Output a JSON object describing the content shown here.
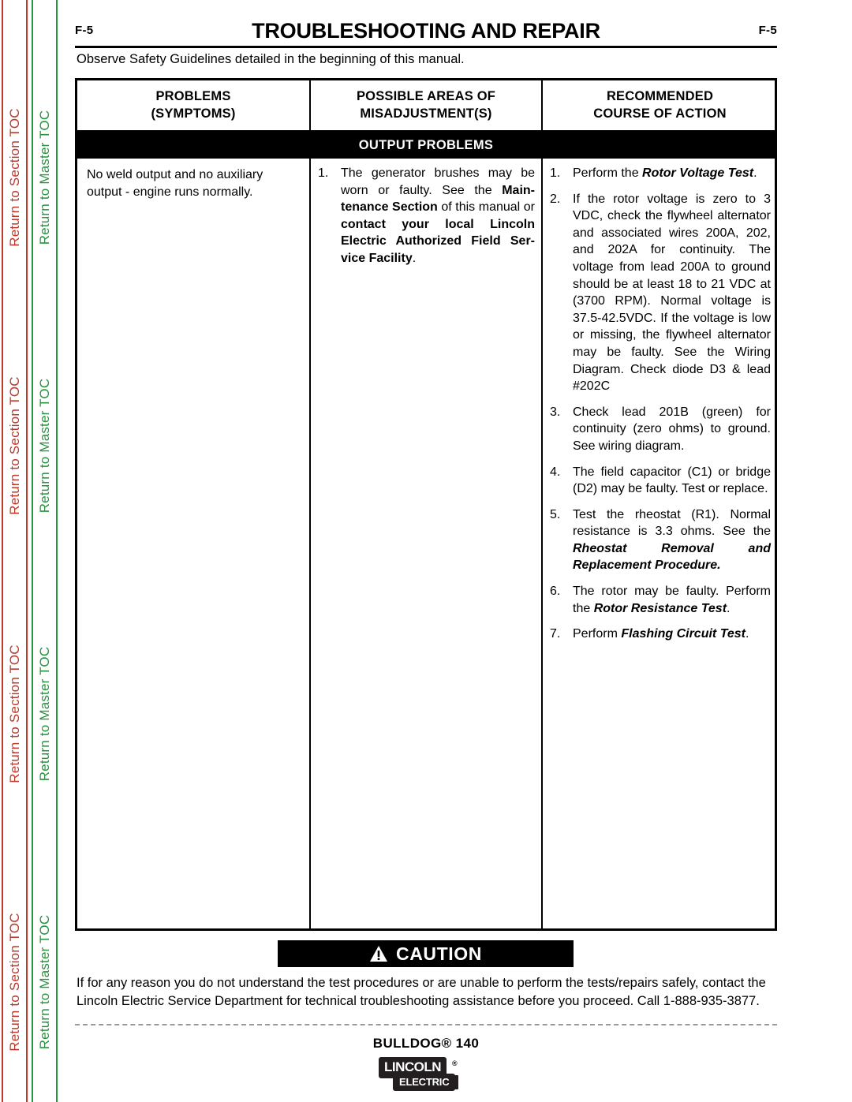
{
  "sidebar": {
    "section_toc_label": "Return to Section TOC",
    "master_toc_label": "Return to Master TOC",
    "section_toc_color": "#c0392b",
    "master_toc_color": "#27943f"
  },
  "header": {
    "folio_left": "F-5",
    "folio_right": "F-5",
    "title": "TROUBLESHOOTING AND REPAIR",
    "intro": "Observe Safety Guidelines detailed in the beginning of this manual."
  },
  "table": {
    "columns": [
      {
        "line1": "PROBLEMS",
        "line2": "(SYMPTOMS)"
      },
      {
        "line1": "POSSIBLE AREAS OF",
        "line2": "MISADJUSTMENT(S)"
      },
      {
        "line1": "RECOMMENDED",
        "line2": "COURSE OF ACTION"
      }
    ],
    "section_bar": "OUTPUT PROBLEMS",
    "symptom": "No weld output and no auxiliary output - engine runs normally.",
    "possible_areas": [
      {
        "num": "1.",
        "parts": [
          {
            "text": "The generator brushes may be worn or faulty.  See the ",
            "style": "normal"
          },
          {
            "text": "Main",
            "style": "bold"
          },
          {
            "text": "-",
            "style": "bold"
          },
          {
            "text": "tenance Section",
            "style": "bold"
          },
          {
            "text": " of this manual or ",
            "style": "normal"
          },
          {
            "text": "contact your local Lincoln Electric Authorized Field Ser",
            "style": "bold"
          },
          {
            "text": "-",
            "style": "bold"
          },
          {
            "text": "vice Facility",
            "style": "bold"
          },
          {
            "text": ".",
            "style": "normal"
          }
        ]
      }
    ],
    "course_of_action": [
      {
        "num": "1.",
        "parts": [
          {
            "text": "Perform the ",
            "style": "normal"
          },
          {
            "text": "Rotor Voltage Test",
            "style": "bolditalic"
          },
          {
            "text": ".",
            "style": "normal"
          }
        ]
      },
      {
        "num": "2.",
        "parts": [
          {
            "text": "If the rotor voltage is zero to 3 VDC, check the flywheel alternator and associated wires 200A, 202, and 202A for continuity.  The voltage from lead 200A to ground should be at least 18 to 21 VDC at (3700 RPM).  Normal voltage is 37.5-42.5VDC.  If the voltage is low or missing, the flywheel alternator may be faulty.  See the Wiring Diagram.  Check diode D3 & lead #202C",
            "style": "normal"
          }
        ]
      },
      {
        "num": "3.",
        "parts": [
          {
            "text": "Check lead 201B (green) for continuity (zero ohms) to ground.  See wiring diagram.",
            "style": "normal"
          }
        ]
      },
      {
        "num": "4.",
        "parts": [
          {
            "text": "The field capacitor (C1) or bridge (D2) may be faulty. Test or replace.",
            "style": "normal"
          }
        ]
      },
      {
        "num": "5.",
        "parts": [
          {
            "text": "Test the rheostat (R1).  Normal resistance is 3.3 ohms.  See the ",
            "style": "normal"
          },
          {
            "text": "Rheostat Removal and Replacement Procedure.",
            "style": "bolditalic"
          }
        ]
      },
      {
        "num": "6.",
        "parts": [
          {
            "text": "The rotor may be faulty.  Perform the ",
            "style": "normal"
          },
          {
            "text": "Rotor Resistance Test",
            "style": "bolditalic"
          },
          {
            "text": ".",
            "style": "normal"
          }
        ]
      },
      {
        "num": "7.",
        "parts": [
          {
            "text": "Perform ",
            "style": "normal"
          },
          {
            "text": "Flashing Circuit Test",
            "style": "bolditalic"
          },
          {
            "text": ".",
            "style": "normal"
          }
        ]
      }
    ]
  },
  "caution": {
    "icon": "warning-triangle-icon",
    "label": "CAUTION",
    "text": "If for any reason you do not understand the test procedures or are unable to perform the tests/repairs safely, contact the Lincoln Electric Service Department for technical troubleshooting assistance before you proceed. Call 1-888-935-3877."
  },
  "footer": {
    "model": "BULLDOG® 140",
    "logo_top": "LINCOLN",
    "logo_reg": "®",
    "logo_bottom": "ELECTRIC"
  }
}
